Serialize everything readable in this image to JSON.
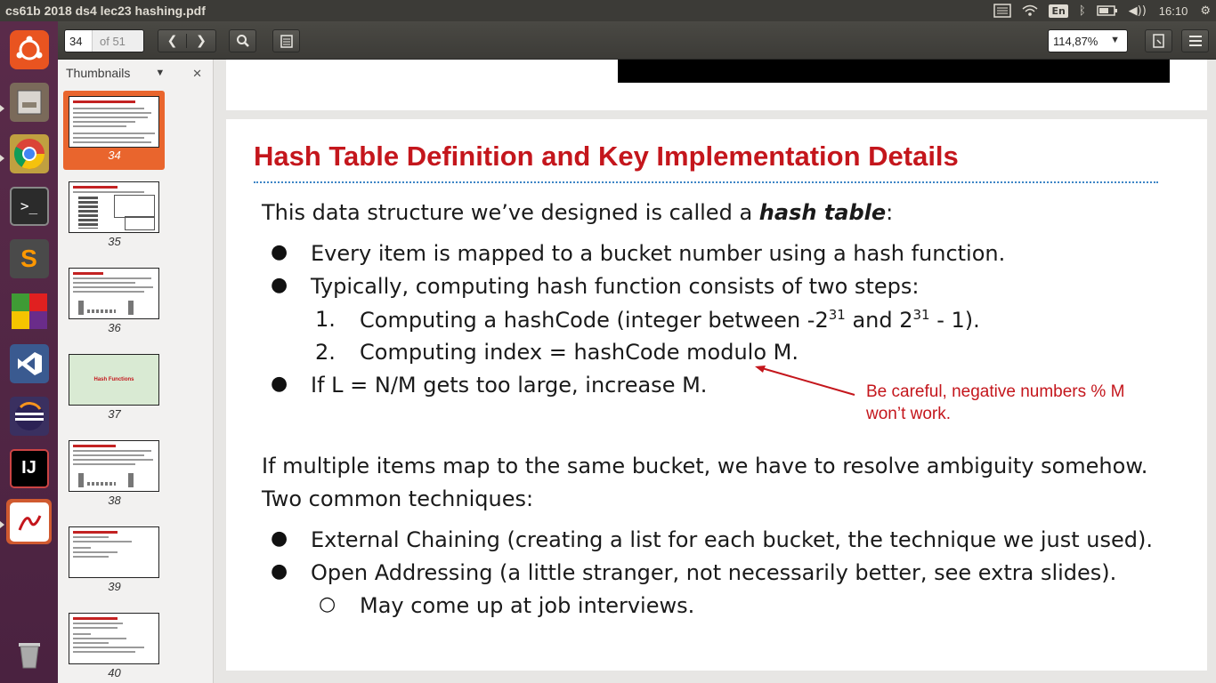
{
  "window": {
    "title": "cs61b 2018 ds4 lec23 hashing.pdf"
  },
  "tray": {
    "lang": "En",
    "time": "16:10"
  },
  "toolbar": {
    "page_current": "34",
    "page_of": "of 51",
    "zoom": "114,87%"
  },
  "sidebar": {
    "header": "Thumbnails",
    "thumbnails": [
      {
        "num": "34",
        "label": "Hash Table Definition and Key Implementation Details",
        "selected": true
      },
      {
        "num": "35",
        "label": "External Chaining Performance"
      },
      {
        "num": "36",
        "label": "Hash Functions"
      },
      {
        "num": "37",
        "label": "Hash Functions"
      },
      {
        "num": "38",
        "label": "What Makes a good .hashCode()?"
      },
      {
        "num": "39",
        "label": "Example: String hashCode function"
      },
      {
        "num": "40",
        "label": "Example: String hashCode function"
      }
    ]
  },
  "slide": {
    "title": "Hash Table Definition and Key Implementation Details",
    "intro_pre": "This data structure we’ve designed is called a ",
    "intro_em": "hash table",
    "intro_post": ":",
    "b1": "Every item is mapped to a bucket number using a hash function.",
    "b2": "Typically, computing hash function consists of two steps:",
    "n1_num": "1.",
    "n1_a": "Computing a hashCode (integer between -2",
    "n1_sup1": "31",
    "n1_b": " and 2",
    "n1_sup2": "31",
    "n1_c": " - 1).",
    "n2_num": "2.",
    "n2": "Computing index = hashCode modulo M.",
    "b3": "If L =  N/M gets too large, increase M.",
    "note_line1": "Be careful, negative numbers % M",
    "note_line2": "won’t work.",
    "p2_line1": "If multiple items map to the same bucket, we have to resolve ambiguity somehow.",
    "p2_line2": "Two common techniques:",
    "b4": "External Chaining (creating a list for each bucket, the technique we just used).",
    "b5": "Open Addressing (a little stranger, not necessarily better, see extra slides).",
    "sub1": "May come up at job interviews.",
    "colors": {
      "title": "#c4161c",
      "accent": "#e9652d"
    }
  }
}
